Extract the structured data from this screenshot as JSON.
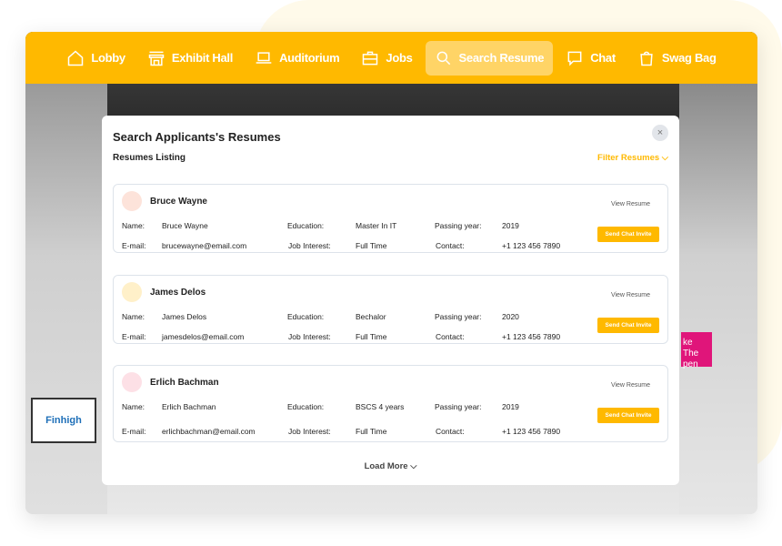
{
  "nav": [
    {
      "label": "Lobby",
      "icon": "home-icon"
    },
    {
      "label": "Exhibit Hall",
      "icon": "store-icon"
    },
    {
      "label": "Auditorium",
      "icon": "laptop-icon"
    },
    {
      "label": "Jobs",
      "icon": "briefcase-icon"
    },
    {
      "label": "Search Resume",
      "icon": "search-icon",
      "active": true
    },
    {
      "label": "Chat",
      "icon": "chat-icon"
    },
    {
      "label": "Swag Bag",
      "icon": "bag-icon"
    }
  ],
  "background": {
    "sign": "Finhigh",
    "banner": "ke The\npen"
  },
  "modal": {
    "title": "Search Applicants's Resumes",
    "close": "×",
    "subtitle": "Resumes Listing",
    "filter": "Filter Resumes",
    "load_more": "Load More"
  },
  "labels": {
    "name": "Name:",
    "email": "E-mail:",
    "education": "Education:",
    "job_interest": "Job Interest:",
    "passing_year": "Passing year:",
    "contact": "Contact:",
    "view": "View Resume",
    "invite": "Send Chat Invite"
  },
  "applicants": [
    {
      "name": "Bruce Wayne",
      "email": "brucewayne@email.com",
      "education": "Master In IT",
      "job_interest": "Full Time",
      "passing_year": "2019",
      "contact": "+1 123 456 7890",
      "avatar_color": "#fde3da"
    },
    {
      "name": "James Delos",
      "email": "jamesdelos@email.com",
      "education": "Bechalor",
      "job_interest": "Full Time",
      "passing_year": "2020",
      "contact": "+1 123 456 7890",
      "avatar_color": "#fff0c9"
    },
    {
      "name": "Erlich Bachman",
      "email": "erlichbachman@email.com",
      "education": "BSCS 4 years",
      "job_interest": "Full Time",
      "passing_year": "2019",
      "contact": "+1 123 456 7890",
      "avatar_color": "#fde0e6"
    }
  ]
}
